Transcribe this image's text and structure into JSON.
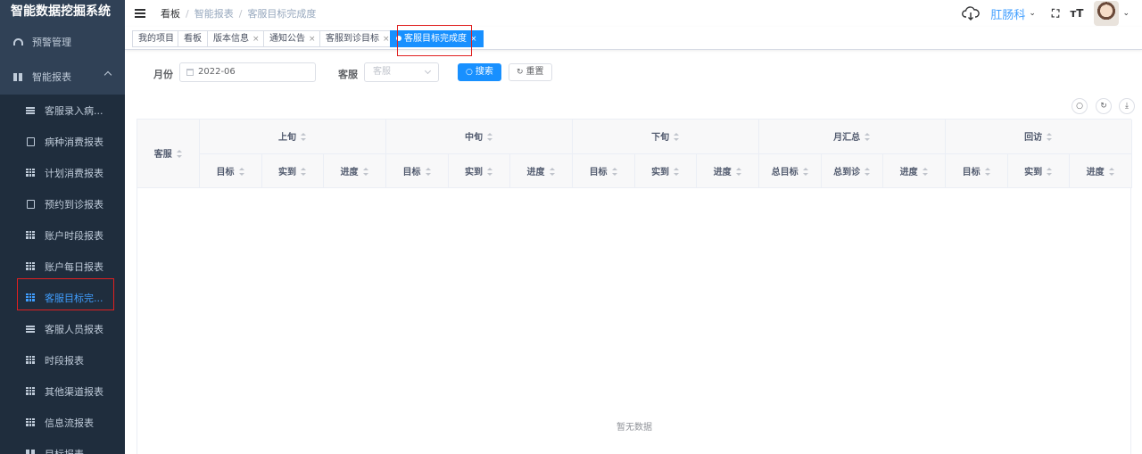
{
  "app_title": "智能数据挖掘系统",
  "sidebar": {
    "top_items": [
      {
        "label": "预警管理",
        "icon": "gauge-icon"
      }
    ],
    "parent": {
      "label": "智能报表",
      "icon": "book-icon"
    },
    "items": [
      {
        "label": "客服录入病...",
        "icon": "list-icon"
      },
      {
        "label": "病种消费报表",
        "icon": "doc-icon"
      },
      {
        "label": "计划消费报表",
        "icon": "grid-icon"
      },
      {
        "label": "预约到诊报表",
        "icon": "doc-icon"
      },
      {
        "label": "账户时段报表",
        "icon": "grid-icon"
      },
      {
        "label": "账户每日报表",
        "icon": "grid-icon"
      },
      {
        "label": "客服目标完...",
        "icon": "grid-icon",
        "active": true
      },
      {
        "label": "客服人员报表",
        "icon": "list-icon"
      },
      {
        "label": "时段报表",
        "icon": "grid-icon"
      },
      {
        "label": "其他渠道报表",
        "icon": "grid-icon"
      },
      {
        "label": "信息流报表",
        "icon": "grid-icon"
      },
      {
        "label": "目标报表",
        "icon": "book-icon"
      }
    ]
  },
  "header": {
    "breadcrumb": [
      "看板",
      "智能报表",
      "客服目标完成度"
    ],
    "department": "肛肠科",
    "caret": "⌄",
    "fullscreen_glyph": "⛶",
    "size_glyph": "тT"
  },
  "tags": [
    {
      "label": "我的项目",
      "closable": false
    },
    {
      "label": "看板",
      "closable": false
    },
    {
      "label": "版本信息",
      "closable": true
    },
    {
      "label": "通知公告",
      "closable": true
    },
    {
      "label": "客服到诊目标",
      "closable": true
    },
    {
      "label": "客服目标完成度",
      "closable": true,
      "active": true
    }
  ],
  "tag_close_glyph": "×",
  "filter": {
    "month_label": "月份",
    "month_value": "2022-06",
    "service_label": "客服",
    "service_placeholder": "客服",
    "search_label": "搜索",
    "reset_label": "重置",
    "search_icon": "search-icon",
    "reset_icon": "refresh-icon"
  },
  "toolbar": {
    "search_glyph": "○",
    "refresh_glyph": "↻",
    "download_glyph": "⤓"
  },
  "table": {
    "first_col": "客服",
    "groups": [
      {
        "label": "上旬",
        "cols": [
          "目标",
          "实到",
          "进度"
        ]
      },
      {
        "label": "中旬",
        "cols": [
          "目标",
          "实到",
          "进度"
        ]
      },
      {
        "label": "下旬",
        "cols": [
          "目标",
          "实到",
          "进度"
        ]
      },
      {
        "label": "月汇总",
        "cols": [
          "总目标",
          "总到诊",
          "进度"
        ]
      },
      {
        "label": "回访",
        "cols": [
          "目标",
          "实到",
          "进度"
        ]
      }
    ],
    "empty_text": "暂无数据"
  },
  "colors": {
    "sidebar_bg": "#304156",
    "submenu_bg": "#1f2d3d",
    "accent": "#1890ff",
    "highlight_border": "#e02020"
  }
}
